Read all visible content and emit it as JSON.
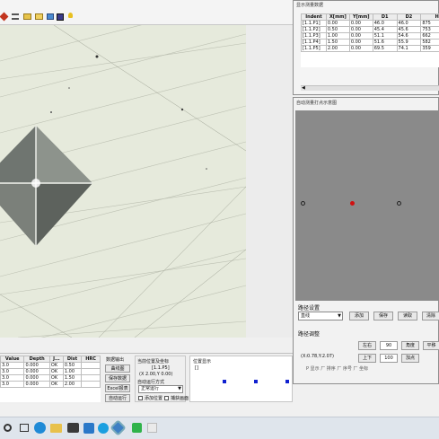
{
  "toolbar": {
    "icons": [
      "pencil-icon",
      "list-icon",
      "folder-icon",
      "open-folder-icon",
      "image-icon",
      "save-icon",
      "lamp-icon"
    ]
  },
  "result_window": {
    "title": "显示测量数据",
    "columns": [
      "Indent",
      "X[mm]",
      "Y[mm]",
      "D1",
      "D2",
      "H"
    ],
    "rows": [
      [
        "[1.1.P1]",
        "0.00",
        "0.00",
        "46.0",
        "46.0",
        "875"
      ],
      [
        "[1.1.P2]",
        "0.50",
        "0.00",
        "45.4",
        "45.6",
        "753"
      ],
      [
        "[1.1.P3]",
        "1.00",
        "0.00",
        "51.1",
        "54.6",
        "662"
      ],
      [
        "[1.1.P4]",
        "1.50",
        "0.00",
        "51.6",
        "55.9",
        "582"
      ],
      [
        "[1.1.P5]",
        "2.00",
        "0.00",
        "69.5",
        "74.1",
        "359"
      ]
    ]
  },
  "auto_point_window": {
    "title": "自动测量打点示意图",
    "path_settings_label": "路径设置",
    "path_select": "直线",
    "add_button": "添加",
    "save_button": "保存",
    "read_button": "读取",
    "clear_button": "清除",
    "path_adjust_label": "路径调整",
    "left_button": "左右",
    "value_90": "90",
    "angle_button": "角度",
    "pan_button": "平移",
    "coord_text": "(X:0.78,Y:2.07)",
    "updown_button": "上下",
    "value_100": "100",
    "add_point_button": "加点",
    "bottom_text": "P 显示  厂 排序  厂 序号  厂 坐标"
  },
  "bottom_panel": {
    "columns": [
      "Value",
      "Depth",
      "J...",
      "Dist",
      "HRC"
    ],
    "rows": [
      [
        "3.0",
        "0.000",
        "OK",
        "0.50"
      ],
      [
        "3.0",
        "0.000",
        "OK",
        "1.00"
      ],
      [
        "3.0",
        "0.000",
        "OK",
        "1.50"
      ],
      [
        "3.0",
        "0.000",
        "OK",
        "2.00"
      ]
    ],
    "data_label": "数据输出",
    "curve_button": "曲线图",
    "save_data_button": "保存数据",
    "excel_button": "Excel报表",
    "auto_run_button": "自动运行",
    "current_pos_label": "当前位置及坐标",
    "pos_line1": "[1.1.P5]",
    "pos_line2": "(X 2.00,Y 0.00)",
    "auto_mode_label": "自动运行方式",
    "mode_select": "正常运行",
    "cb_add_position": "添加位置",
    "cb_view_image": "捕获画面",
    "position_display_label": "位置显示",
    "position_value": "[]"
  },
  "taskbar": {
    "icons": [
      "search-icon",
      "task-view-icon",
      "edge-icon",
      "folder-icon",
      "mail-icon",
      "store-icon",
      "skype-icon",
      "settings-icon",
      "app-icon",
      "excel-icon"
    ]
  },
  "colors": {
    "taskbar": "#dfe5ec",
    "canvas_gray": "#8a8a8a",
    "point_red": "#d01010",
    "point_dark": "#222222",
    "marker_blue": "#1020d0"
  }
}
